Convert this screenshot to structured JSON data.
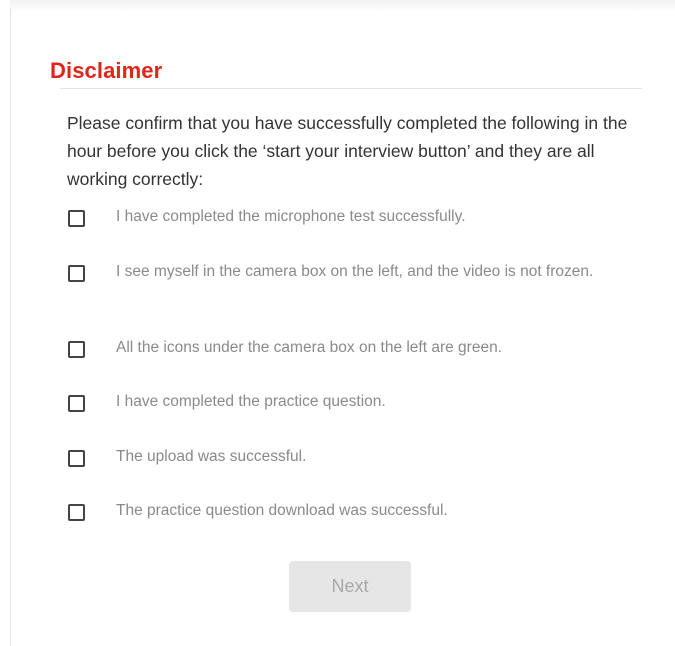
{
  "disclaimer": {
    "title": "Disclaimer",
    "intro": "Please confirm that you have successfully completed the following in the hour before you click the ‘start your interview button’ and they are all working correctly:",
    "items": [
      {
        "label": "I have completed the microphone test successfully.",
        "checked": false
      },
      {
        "label": "I see myself in the camera box on the left, and the video is not frozen.",
        "checked": false
      },
      {
        "label": "All the icons under the camera box on the left are green.",
        "checked": false
      },
      {
        "label": "I have completed the practice question.",
        "checked": false
      },
      {
        "label": "The upload was successful.",
        "checked": false
      },
      {
        "label": "The practice question download was successful.",
        "checked": false
      }
    ],
    "next_label": "Next",
    "next_enabled": false
  },
  "colors": {
    "title": "#e0261b",
    "intro_text": "#333333",
    "item_text": "#8a8a8a",
    "button_bg": "#e6e6e6",
    "button_text": "#a8a8a8"
  }
}
